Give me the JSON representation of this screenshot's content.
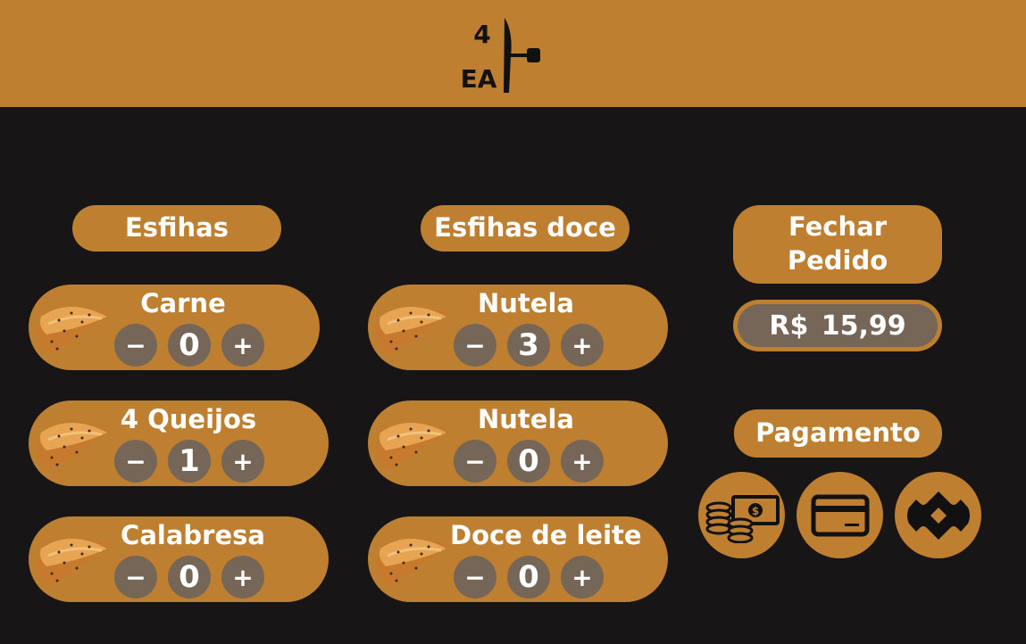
{
  "app": {
    "logo_number": "4",
    "logo_letters": "EA"
  },
  "menu": {
    "savory_title": "Esfihas",
    "sweet_title": "Esfihas doce",
    "savory": [
      {
        "name": "Carne",
        "qty": "0"
      },
      {
        "name": "4 Queijos",
        "qty": "1"
      },
      {
        "name": "Calabresa",
        "qty": "0"
      }
    ],
    "sweet": [
      {
        "name": "Nutela",
        "qty": "3"
      },
      {
        "name": "Nutela",
        "qty": "0"
      },
      {
        "name": "Doce de leite",
        "qty": "0"
      }
    ],
    "minus_label": "−",
    "plus_label": "+"
  },
  "checkout": {
    "close_order_line1": "Fechar",
    "close_order_line2": "Pedido",
    "total": "R$ 15,99",
    "payment_title": "Pagamento",
    "payment_methods": [
      "cash-icon",
      "credit-card-icon",
      "pix-icon"
    ]
  },
  "colors": {
    "primary": "#bf7f30",
    "background": "#171515",
    "control": "#756658",
    "text": "#ffffff",
    "icon": "#111111"
  }
}
